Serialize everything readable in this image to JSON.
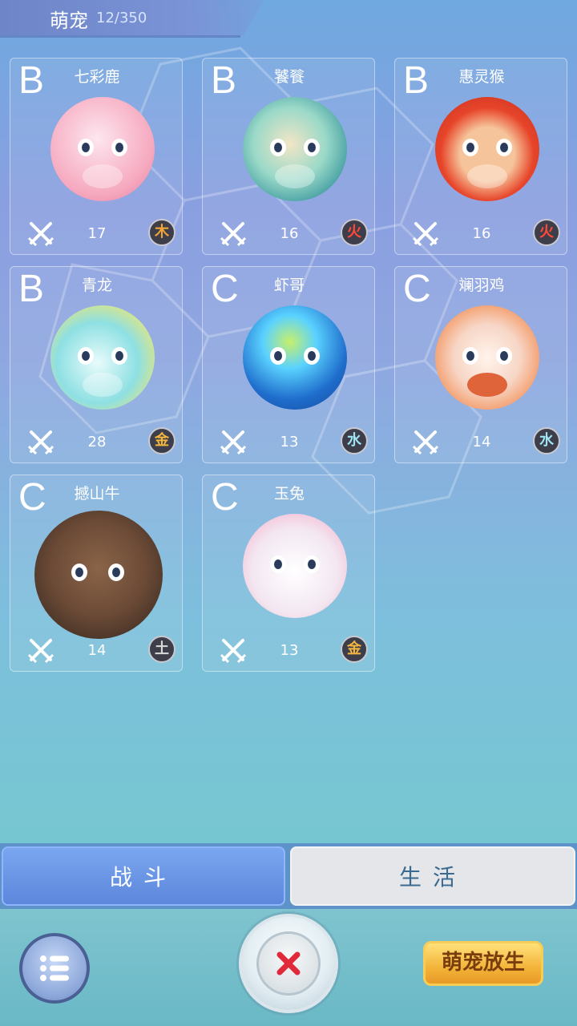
{
  "header": {
    "title": "萌宠",
    "count": "12/350"
  },
  "pets": [
    {
      "grade": "B",
      "name": "七彩鹿",
      "power": "17",
      "element": "木",
      "element_type": "wood",
      "color": "#f6a9bf",
      "accent": "#fde6ef"
    },
    {
      "grade": "B",
      "name": "饕餮",
      "power": "16",
      "element": "火",
      "element_type": "fire",
      "color": "#5fc2b0",
      "accent": "#2e8f98"
    },
    {
      "grade": "B",
      "name": "惠灵猴",
      "power": "16",
      "element": "火",
      "element_type": "fire",
      "color": "#e7452a",
      "accent": "#f6c49a"
    },
    {
      "grade": "B",
      "name": "青龙",
      "power": "28",
      "element": "金",
      "element_type": "metal",
      "color": "#8ee0e3",
      "accent": "#f1e66e"
    },
    {
      "grade": "C",
      "name": "虾哥",
      "power": "13",
      "element": "水",
      "element_type": "water",
      "color": "#1f6dcc",
      "accent": "#5ad2ff"
    },
    {
      "grade": "C",
      "name": "斓羽鸡",
      "power": "14",
      "element": "水",
      "element_type": "water",
      "color": "#f7d6c6",
      "accent": "#f28a4e"
    },
    {
      "grade": "C",
      "name": "撼山牛",
      "power": "14",
      "element": "土",
      "element_type": "earth",
      "color": "#6b4a36",
      "accent": "#3b2b22"
    },
    {
      "grade": "C",
      "name": "玉兔",
      "power": "13",
      "element": "金",
      "element_type": "metal",
      "color": "#f3e7f2",
      "accent": "#f4b6cf"
    }
  ],
  "tabs": {
    "battle": "战斗",
    "life": "生活"
  },
  "actions": {
    "release": "萌宠放生"
  },
  "icons": {
    "attack": "crossed-swords-icon",
    "menu": "list-icon",
    "close": "close-x-icon"
  }
}
